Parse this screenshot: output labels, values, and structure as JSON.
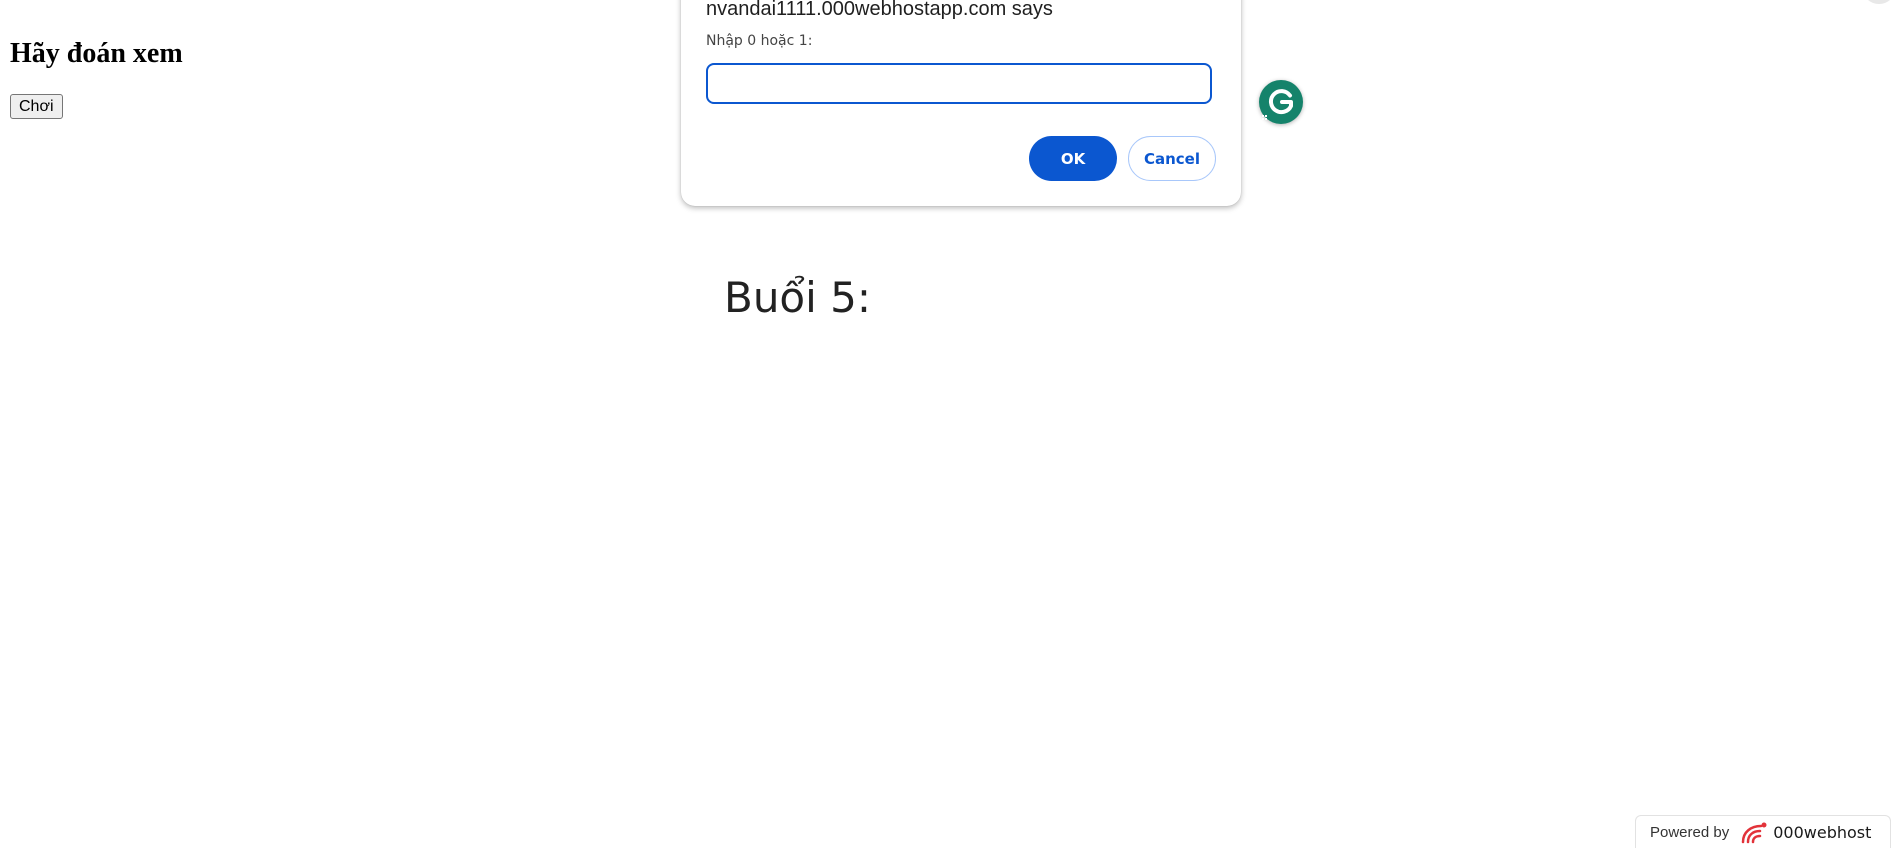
{
  "page": {
    "heading": "Hãy đoán xem",
    "play_button_label": "Chơi",
    "section_title": "Buổi 5:"
  },
  "dialog": {
    "title": "nvandai1111.000webhostapp.com says",
    "message": "Nhập 0 hoặc 1:",
    "input_value": "",
    "ok_label": "OK",
    "cancel_label": "Cancel",
    "accent_color": "#0b57d0"
  },
  "extension": {
    "icon": "grammarly-icon",
    "color": "#15836b"
  },
  "badge": {
    "powered_text": "Powered by",
    "brand_name": "000webhost",
    "logo_icon": "000webhost-logo-icon",
    "logo_color": "#e2333a"
  }
}
